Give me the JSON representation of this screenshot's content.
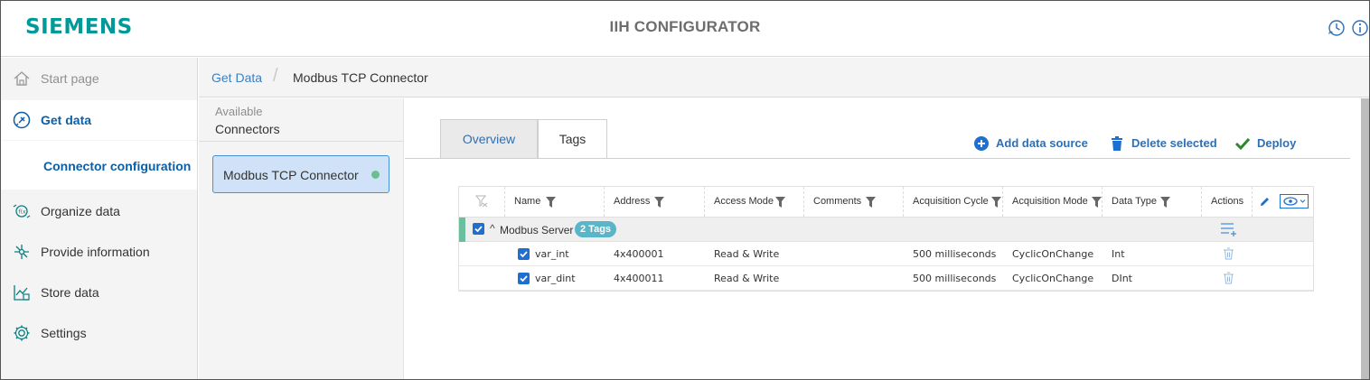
{
  "header": {
    "logo": "SIEMENS",
    "title": "IIH CONFIGURATOR",
    "icons": [
      "history-icon",
      "info-icon"
    ],
    "brand_color": "#009999"
  },
  "sidebar": {
    "items": [
      {
        "label": "Start page",
        "icon": "home-icon"
      },
      {
        "label": "Get data",
        "icon": "plug-icon"
      },
      {
        "label": "Connector configuration"
      },
      {
        "label": "Organize data",
        "icon": "organize-icon"
      },
      {
        "label": "Provide information",
        "icon": "provide-icon"
      },
      {
        "label": "Store data",
        "icon": "store-icon"
      },
      {
        "label": "Settings",
        "icon": "gear-icon"
      }
    ]
  },
  "breadcrumb": {
    "link": "Get Data",
    "separator": "/",
    "current": "Modbus TCP Connector"
  },
  "connectors": {
    "available_label": "Available",
    "heading": "Connectors",
    "items": [
      {
        "label": "Modbus TCP Connector",
        "status_color": "#6bbf8e"
      }
    ]
  },
  "tabs": [
    {
      "label": "Overview"
    },
    {
      "label": "Tags"
    }
  ],
  "actions": {
    "add": "Add data source",
    "delete": "Delete selected",
    "deploy": "Deploy"
  },
  "table": {
    "columns": [
      "Name",
      "Address",
      "Access Mode",
      "Comments",
      "Acquisition Cycle",
      "Acquisition Mode",
      "Data Type",
      "Actions"
    ],
    "group": {
      "label": "Modbus Server",
      "badge": "2 Tags"
    },
    "rows": [
      {
        "name": "var_int",
        "address": "4x400001",
        "access": "Read & Write",
        "comments": "",
        "cycle": "500 milliseconds",
        "mode": "CyclicOnChange",
        "type": "Int"
      },
      {
        "name": "var_dint",
        "address": "4x400011",
        "access": "Read & Write",
        "comments": "",
        "cycle": "500 milliseconds",
        "mode": "CyclicOnChange",
        "type": "DInt"
      }
    ]
  }
}
